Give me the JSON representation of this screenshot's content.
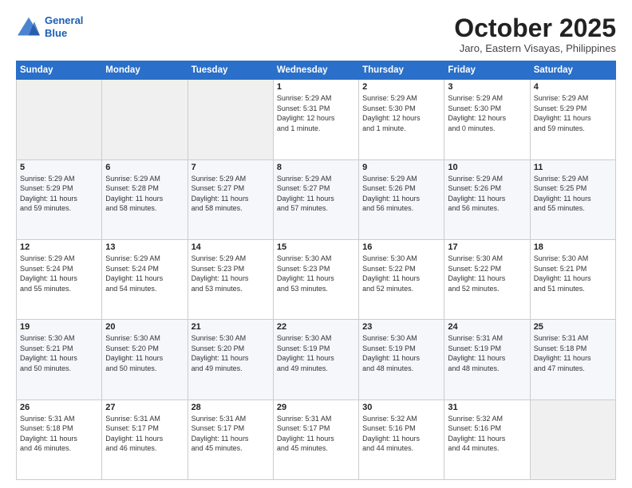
{
  "header": {
    "logo_line1": "General",
    "logo_line2": "Blue",
    "month": "October 2025",
    "location": "Jaro, Eastern Visayas, Philippines"
  },
  "weekdays": [
    "Sunday",
    "Monday",
    "Tuesday",
    "Wednesday",
    "Thursday",
    "Friday",
    "Saturday"
  ],
  "weeks": [
    [
      {
        "day": "",
        "content": ""
      },
      {
        "day": "",
        "content": ""
      },
      {
        "day": "",
        "content": ""
      },
      {
        "day": "1",
        "content": "Sunrise: 5:29 AM\nSunset: 5:31 PM\nDaylight: 12 hours\nand 1 minute."
      },
      {
        "day": "2",
        "content": "Sunrise: 5:29 AM\nSunset: 5:30 PM\nDaylight: 12 hours\nand 1 minute."
      },
      {
        "day": "3",
        "content": "Sunrise: 5:29 AM\nSunset: 5:30 PM\nDaylight: 12 hours\nand 0 minutes."
      },
      {
        "day": "4",
        "content": "Sunrise: 5:29 AM\nSunset: 5:29 PM\nDaylight: 11 hours\nand 59 minutes."
      }
    ],
    [
      {
        "day": "5",
        "content": "Sunrise: 5:29 AM\nSunset: 5:29 PM\nDaylight: 11 hours\nand 59 minutes."
      },
      {
        "day": "6",
        "content": "Sunrise: 5:29 AM\nSunset: 5:28 PM\nDaylight: 11 hours\nand 58 minutes."
      },
      {
        "day": "7",
        "content": "Sunrise: 5:29 AM\nSunset: 5:27 PM\nDaylight: 11 hours\nand 58 minutes."
      },
      {
        "day": "8",
        "content": "Sunrise: 5:29 AM\nSunset: 5:27 PM\nDaylight: 11 hours\nand 57 minutes."
      },
      {
        "day": "9",
        "content": "Sunrise: 5:29 AM\nSunset: 5:26 PM\nDaylight: 11 hours\nand 56 minutes."
      },
      {
        "day": "10",
        "content": "Sunrise: 5:29 AM\nSunset: 5:26 PM\nDaylight: 11 hours\nand 56 minutes."
      },
      {
        "day": "11",
        "content": "Sunrise: 5:29 AM\nSunset: 5:25 PM\nDaylight: 11 hours\nand 55 minutes."
      }
    ],
    [
      {
        "day": "12",
        "content": "Sunrise: 5:29 AM\nSunset: 5:24 PM\nDaylight: 11 hours\nand 55 minutes."
      },
      {
        "day": "13",
        "content": "Sunrise: 5:29 AM\nSunset: 5:24 PM\nDaylight: 11 hours\nand 54 minutes."
      },
      {
        "day": "14",
        "content": "Sunrise: 5:29 AM\nSunset: 5:23 PM\nDaylight: 11 hours\nand 53 minutes."
      },
      {
        "day": "15",
        "content": "Sunrise: 5:30 AM\nSunset: 5:23 PM\nDaylight: 11 hours\nand 53 minutes."
      },
      {
        "day": "16",
        "content": "Sunrise: 5:30 AM\nSunset: 5:22 PM\nDaylight: 11 hours\nand 52 minutes."
      },
      {
        "day": "17",
        "content": "Sunrise: 5:30 AM\nSunset: 5:22 PM\nDaylight: 11 hours\nand 52 minutes."
      },
      {
        "day": "18",
        "content": "Sunrise: 5:30 AM\nSunset: 5:21 PM\nDaylight: 11 hours\nand 51 minutes."
      }
    ],
    [
      {
        "day": "19",
        "content": "Sunrise: 5:30 AM\nSunset: 5:21 PM\nDaylight: 11 hours\nand 50 minutes."
      },
      {
        "day": "20",
        "content": "Sunrise: 5:30 AM\nSunset: 5:20 PM\nDaylight: 11 hours\nand 50 minutes."
      },
      {
        "day": "21",
        "content": "Sunrise: 5:30 AM\nSunset: 5:20 PM\nDaylight: 11 hours\nand 49 minutes."
      },
      {
        "day": "22",
        "content": "Sunrise: 5:30 AM\nSunset: 5:19 PM\nDaylight: 11 hours\nand 49 minutes."
      },
      {
        "day": "23",
        "content": "Sunrise: 5:30 AM\nSunset: 5:19 PM\nDaylight: 11 hours\nand 48 minutes."
      },
      {
        "day": "24",
        "content": "Sunrise: 5:31 AM\nSunset: 5:19 PM\nDaylight: 11 hours\nand 48 minutes."
      },
      {
        "day": "25",
        "content": "Sunrise: 5:31 AM\nSunset: 5:18 PM\nDaylight: 11 hours\nand 47 minutes."
      }
    ],
    [
      {
        "day": "26",
        "content": "Sunrise: 5:31 AM\nSunset: 5:18 PM\nDaylight: 11 hours\nand 46 minutes."
      },
      {
        "day": "27",
        "content": "Sunrise: 5:31 AM\nSunset: 5:17 PM\nDaylight: 11 hours\nand 46 minutes."
      },
      {
        "day": "28",
        "content": "Sunrise: 5:31 AM\nSunset: 5:17 PM\nDaylight: 11 hours\nand 45 minutes."
      },
      {
        "day": "29",
        "content": "Sunrise: 5:31 AM\nSunset: 5:17 PM\nDaylight: 11 hours\nand 45 minutes."
      },
      {
        "day": "30",
        "content": "Sunrise: 5:32 AM\nSunset: 5:16 PM\nDaylight: 11 hours\nand 44 minutes."
      },
      {
        "day": "31",
        "content": "Sunrise: 5:32 AM\nSunset: 5:16 PM\nDaylight: 11 hours\nand 44 minutes."
      },
      {
        "day": "",
        "content": ""
      }
    ]
  ]
}
